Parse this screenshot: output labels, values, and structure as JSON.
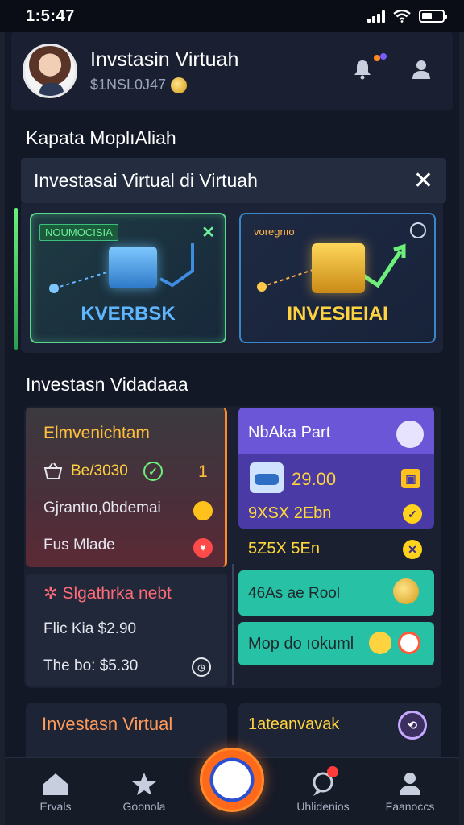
{
  "status_bar": {
    "time": "1:5:47"
  },
  "header": {
    "title": "Invstasin Virtuah",
    "subtitle": "$1NSL0J47",
    "avatar_icon": "profile-photo",
    "actions": [
      "bell-icon",
      "user-icon"
    ]
  },
  "section_top": {
    "heading": "Kapata MoplıAliah"
  },
  "banner": {
    "title": "Investasai Virtual di Virtuah",
    "close_icon": "close-icon",
    "cards": [
      {
        "tag": "NOUMOCISIA",
        "label": "KVERBSK"
      },
      {
        "tag": "voregnıo",
        "label": "INVESIEIAI"
      }
    ]
  },
  "section_mid": {
    "heading": "Investasn Vidadaaa"
  },
  "tiles": {
    "red": {
      "title": "Elmvenichtam",
      "row1_label": "Be/3030",
      "row1_value": "1",
      "row2_label": "Gjrantıo,0bdemai",
      "row3_label": "Fus Mlade"
    },
    "purple": {
      "title": "NbAka Part",
      "amount": "29.00",
      "row2": "9XSX 2Ebn",
      "row3": "5Z5X 5En"
    },
    "dark": {
      "title": "Slgathrka nebt",
      "row1": "Flic Kia $2.90",
      "row2": "The bo: $5.30"
    },
    "teal": {
      "row1": "46As ae Rool",
      "row2": "Mop do ıokuml"
    }
  },
  "lower": {
    "left_title": "Investasn Virtual",
    "right_title": "1ateanvavak"
  },
  "bottom_nav": {
    "items": [
      {
        "label": "Ervals",
        "icon": "home-icon"
      },
      {
        "label": "Goonola",
        "icon": "star-icon"
      },
      {
        "label": "Uhlidenios",
        "icon": "chat-icon"
      },
      {
        "label": "Faanoccs",
        "icon": "profile-icon"
      }
    ]
  },
  "colors": {
    "accent_green": "#59d78f",
    "accent_orange": "#ff8a2a",
    "accent_purple": "#6b56d8",
    "accent_teal": "#27c2a6"
  }
}
